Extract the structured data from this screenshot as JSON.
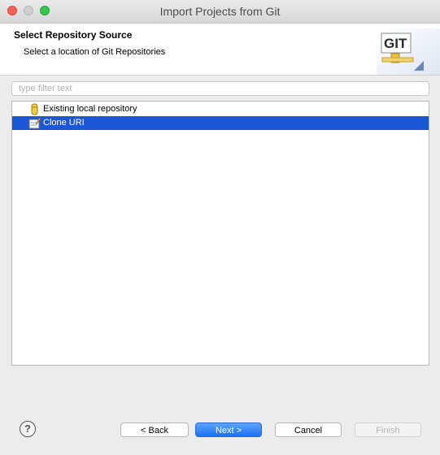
{
  "window": {
    "title": "Import Projects from Git"
  },
  "header": {
    "title": "Select Repository Source",
    "description": "Select a location of Git Repositories",
    "logo_text": "GIT"
  },
  "filter": {
    "placeholder": "type filter text",
    "value": ""
  },
  "sources": [
    {
      "label": "Existing local repository",
      "icon": "local-repository-icon",
      "selected": false
    },
    {
      "label": "Clone URI",
      "icon": "clone-uri-icon",
      "selected": true
    }
  ],
  "buttons": {
    "help": "?",
    "back": "< Back",
    "next": "Next >",
    "cancel": "Cancel",
    "finish": "Finish"
  },
  "colors": {
    "selection": "#1a56d6",
    "primary_button": "#1a6ff5",
    "close": "#fc5f57",
    "maximize": "#34c84a"
  }
}
